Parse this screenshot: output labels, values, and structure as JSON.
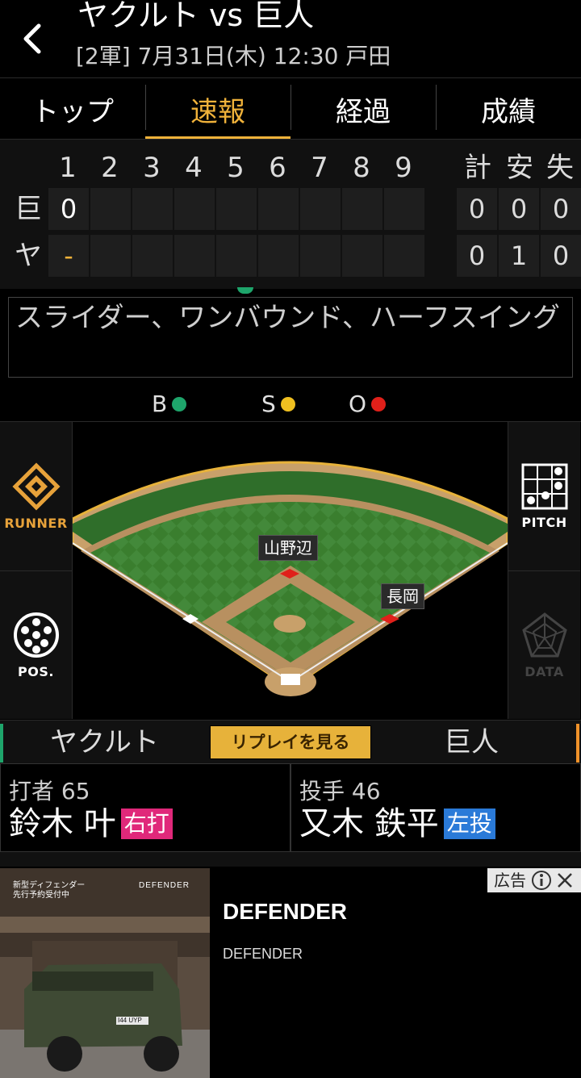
{
  "header": {
    "title": "ヤクルト vs 巨人",
    "subtitle": "[2軍] 7月31日(木) 12:30 戸田"
  },
  "tabs": [
    {
      "label": "トップ",
      "active": false
    },
    {
      "label": "速報",
      "active": true
    },
    {
      "label": "経過",
      "active": false
    },
    {
      "label": "成績",
      "active": false
    }
  ],
  "scoreboard": {
    "innings": [
      "1",
      "2",
      "3",
      "4",
      "5",
      "6",
      "7",
      "8",
      "9"
    ],
    "totals_headers": [
      "計",
      "安",
      "失"
    ],
    "teams": [
      {
        "abbr": "巨",
        "innings": [
          "0",
          "",
          "",
          "",
          "",
          "",
          "",
          "",
          ""
        ],
        "totals": [
          "0",
          "0",
          "0"
        ]
      },
      {
        "abbr": "ヤ",
        "innings": [
          "-",
          "",
          "",
          "",
          "",
          "",
          "",
          "",
          ""
        ],
        "totals": [
          "0",
          "1",
          "0"
        ]
      }
    ]
  },
  "comment": "スライダー、ワンバウンド、ハーフスイング",
  "bso": {
    "b_label": "B",
    "s_label": "S",
    "o_label": "O",
    "b_color": "#1ea56b",
    "s_color": "#f0c020",
    "o_color": "#e0201a",
    "balls": 1,
    "strikes": 1,
    "outs": 1
  },
  "side_buttons": {
    "runner": {
      "label": "RUNNER",
      "icon": "runner-diamond-icon",
      "color": "#e7a23a"
    },
    "pos": {
      "label": "POS.",
      "icon": "positions-icon"
    },
    "pitch": {
      "label": "PITCH",
      "icon": "pitch-grid-icon"
    },
    "data": {
      "label": "DATA",
      "icon": "radar-chart-icon"
    }
  },
  "field": {
    "fielders": {
      "second_base": "山野辺",
      "first_base": "長岡"
    }
  },
  "teambar": {
    "left_team": "ヤクルト",
    "replay": "リプレイを見る",
    "right_team": "巨人"
  },
  "batter": {
    "role": "打者 65",
    "name": "鈴木 叶",
    "tag": "右打",
    "tag_color": "#e0287a"
  },
  "pitcher": {
    "role": "投手 46",
    "name": "又木 鉄平",
    "tag": "左投",
    "tag_color": "#2a7ad8"
  },
  "ad": {
    "title": "DEFENDER",
    "sub": "DEFENDER",
    "badge": "広告",
    "img_text_left": "新型ディフェンダー 先行予約受付中",
    "img_brand": "DEFENDER",
    "plate": "I44 UYP"
  }
}
